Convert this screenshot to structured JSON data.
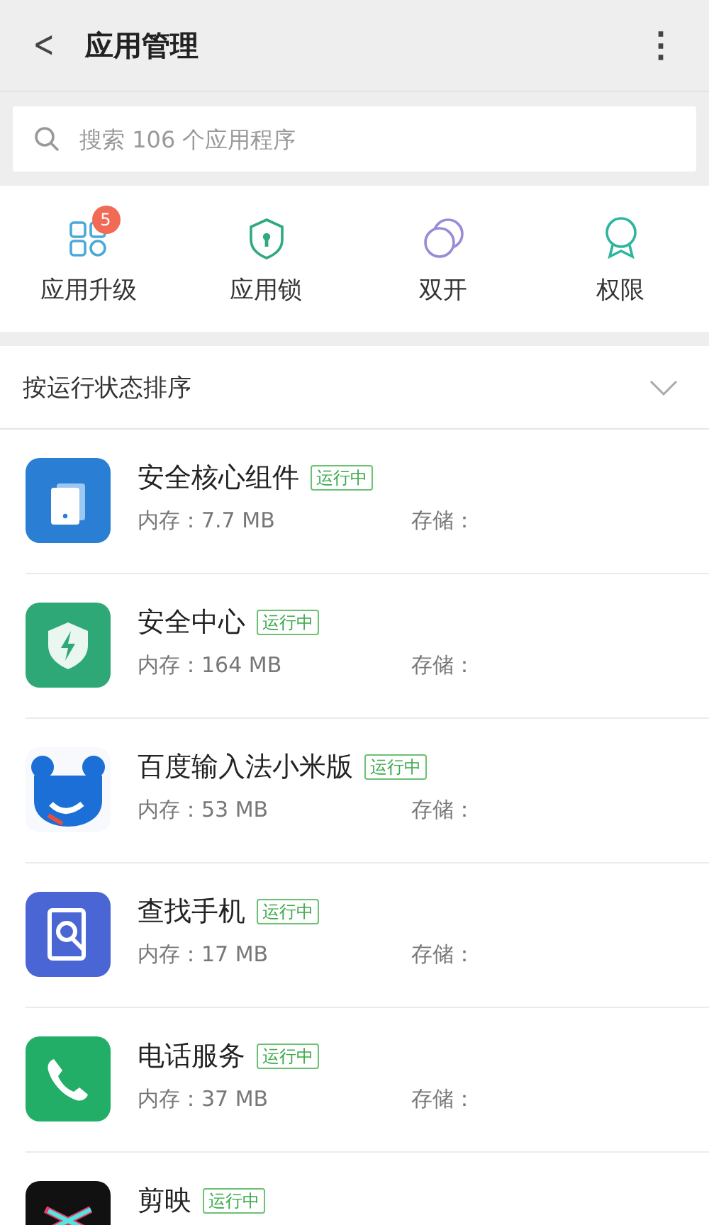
{
  "header": {
    "back": "<",
    "title": "应用管理",
    "menu": "⋮"
  },
  "search": {
    "placeholder": "搜索 106 个应用程序"
  },
  "shortcuts": [
    {
      "kind": "upgrade",
      "label": "应用升级",
      "badge": "5"
    },
    {
      "kind": "lock",
      "label": "应用锁"
    },
    {
      "kind": "dual",
      "label": "双开"
    },
    {
      "kind": "permission",
      "label": "权限"
    }
  ],
  "sort": {
    "label": "按运行状态排序"
  },
  "apps": [
    {
      "kind": "core",
      "name": "安全核心组件",
      "status": "运行中",
      "memory": "内存：7.7 MB",
      "storage": "存储："
    },
    {
      "kind": "security",
      "name": "安全中心",
      "status": "运行中",
      "memory": "内存：164 MB",
      "storage": "存储："
    },
    {
      "kind": "keyboard",
      "name": "百度输入法小米版",
      "status": "运行中",
      "memory": "内存：53 MB",
      "storage": "存储："
    },
    {
      "kind": "find",
      "name": "查找手机",
      "status": "运行中",
      "memory": "内存：17 MB",
      "storage": "存储："
    },
    {
      "kind": "phone",
      "name": "电话服务",
      "status": "运行中",
      "memory": "内存：37 MB",
      "storage": "存储："
    },
    {
      "kind": "video",
      "name": "剪映",
      "status": "运行中"
    }
  ]
}
